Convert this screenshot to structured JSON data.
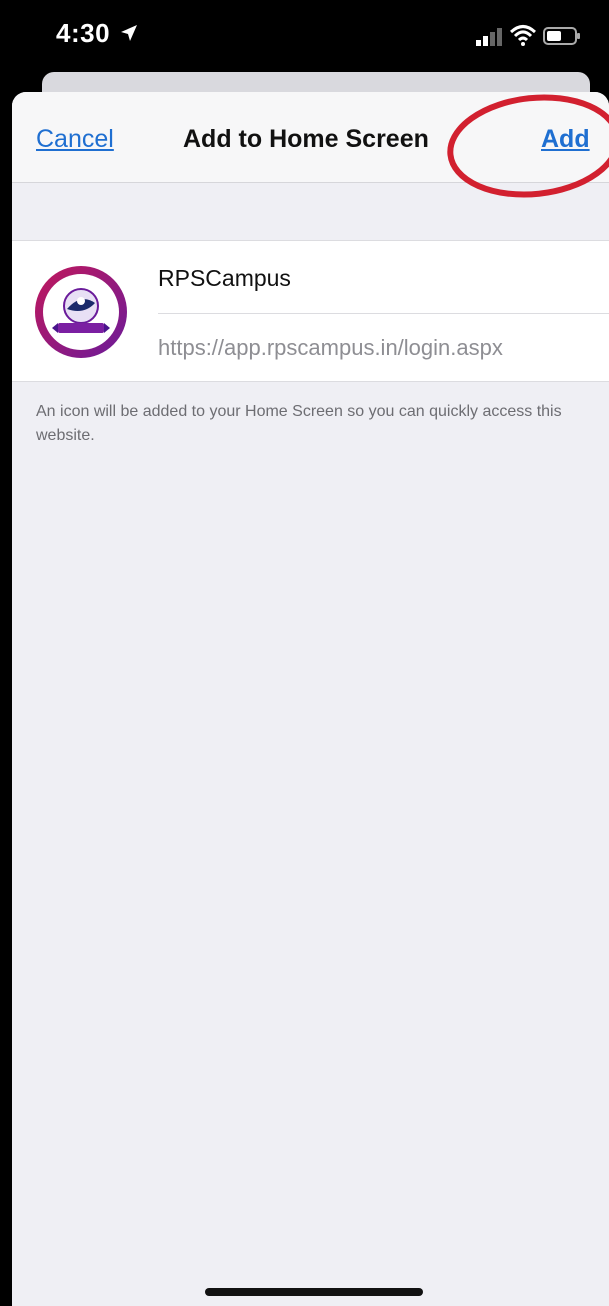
{
  "status_bar": {
    "time": "4:30",
    "icons": [
      "location-arrow-icon",
      "signal-icon",
      "wifi-icon",
      "battery-icon"
    ]
  },
  "nav": {
    "cancel_label": "Cancel",
    "title": "Add to Home Screen",
    "add_label": "Add"
  },
  "bookmark": {
    "icon": "rps-school-logo",
    "name": "RPSCampus",
    "url": "https://app.rpscampus.in/login.aspx"
  },
  "footer_note": "An icon will be added to your Home Screen so you can quickly access this website.",
  "colors": {
    "accent": "#1f6fd1",
    "annotation": "#d2202f",
    "sheet_background": "#efeff4"
  }
}
